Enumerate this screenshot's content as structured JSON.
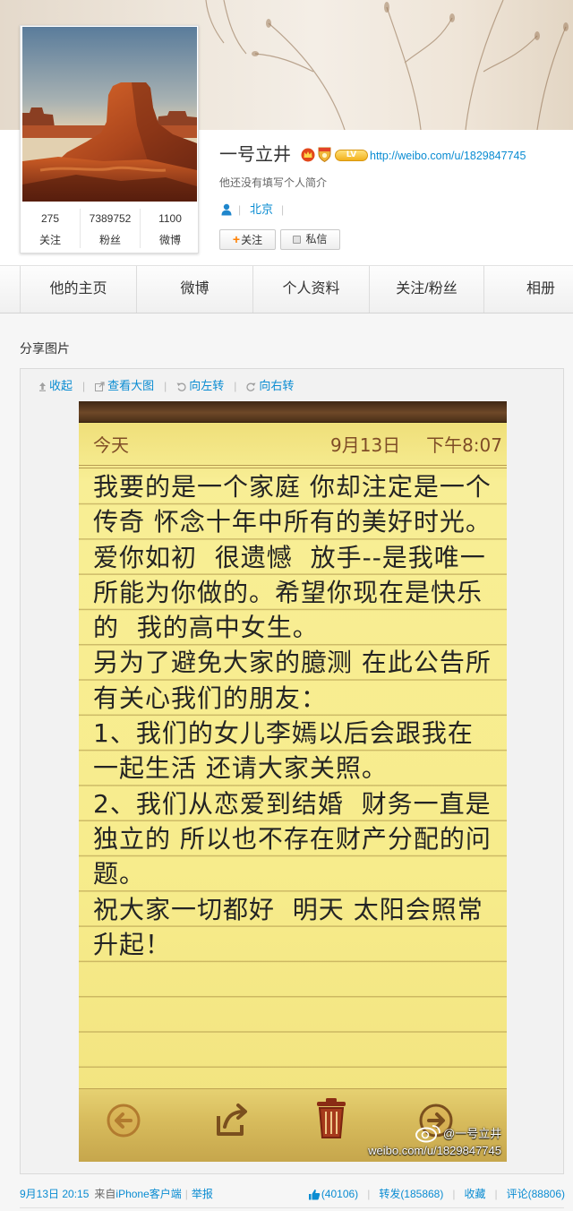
{
  "colors": {
    "link": "#0a8cd2",
    "follow_plus": "#ff7f00",
    "note_paper": "#f5e988",
    "note_header": "#7f4d27",
    "note_text": "#242424"
  },
  "profile": {
    "name": "一号立井",
    "level_badge": "LV",
    "url": "http://weibo.com/u/1829847745",
    "bio": "他还没有填写个人简介",
    "location": "北京",
    "separator": "|",
    "stats": [
      {
        "value": "275",
        "label": "关注"
      },
      {
        "value": "7389752",
        "label": "粉丝"
      },
      {
        "value": "1100",
        "label": "微博"
      }
    ],
    "follow": {
      "plus": "+",
      "label": "关注"
    },
    "message_label": "私信",
    "icons": [
      "crown-icon",
      "medal-icon",
      "level-badge-icon",
      "person-icon",
      "message-icon"
    ]
  },
  "nav": {
    "tabs": [
      {
        "label": "他的主页"
      },
      {
        "label": "微博"
      },
      {
        "label": "个人资料"
      },
      {
        "label": "关注/粉丝"
      },
      {
        "label": "相册"
      }
    ]
  },
  "section_title": "分享图片",
  "toolbar": {
    "collapse": "收起",
    "view_large": "查看大图",
    "rotate_left": "向左转",
    "rotate_right": "向右转",
    "separator": "|"
  },
  "note": {
    "header_left": "今天",
    "date": "9月13日",
    "time": "下午8:07",
    "lines": [
      "我要的是一个家庭 你却注定是一个",
      "传奇 怀念十年中所有的美好时光。",
      "爱你如初  很遗憾  放手--是我唯一",
      "所能为你做的。希望你现在是快乐",
      "的  我的高中女生。",
      "另为了避免大家的臆测 在此公告所",
      "有关心我们的朋友：",
      "1、我们的女儿李嫣以后会跟我在",
      "一起生活 还请大家关照。",
      "2、我们从恋爱到结婚  财务一直是",
      "独立的 所以也不存在财产分配的问",
      "题。",
      "祝大家一切都好  明天 太阳会照常",
      "升起！"
    ],
    "toolbar_icons": [
      "back-arrow-icon",
      "share-icon",
      "trash-icon",
      "forward-arrow-icon"
    ]
  },
  "watermark": {
    "handle": "@一号立井",
    "url": "weibo.com/u/1829847745"
  },
  "footer": {
    "time": "9月13日 20:15",
    "from": "来自",
    "source": "iPhone客户端",
    "report": "举报",
    "likes": "(40106)",
    "repost": "转发(185868)",
    "favorite": "收藏",
    "comment": "评论(88806)",
    "separator": "|"
  }
}
